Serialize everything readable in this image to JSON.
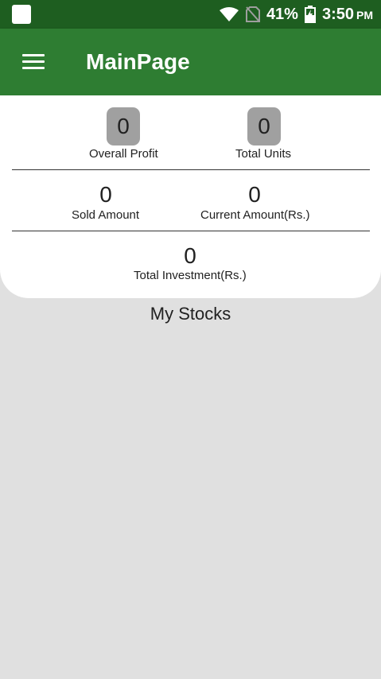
{
  "status_bar": {
    "battery": "41%",
    "time": "3:50",
    "ampm": "PM",
    "icons": [
      "app-notification-icon",
      "wifi-icon",
      "no-sim-icon",
      "battery-charging-icon"
    ]
  },
  "app_bar": {
    "title": "MainPage",
    "menu_icon": "hamburger-menu-icon",
    "color": "#2e7d32"
  },
  "summary": {
    "overall_profit": {
      "value": "0",
      "label": "Overall Profit"
    },
    "total_units": {
      "value": "0",
      "label": "Total Units"
    },
    "sold_amount": {
      "value": "0",
      "label": "Sold Amount"
    },
    "current_amount": {
      "value": "0",
      "label": "Current Amount(Rs.)"
    },
    "total_investment": {
      "value": "0",
      "label": "Total Investment(Rs.)"
    }
  },
  "stocks": {
    "title": "My Stocks",
    "items": []
  }
}
